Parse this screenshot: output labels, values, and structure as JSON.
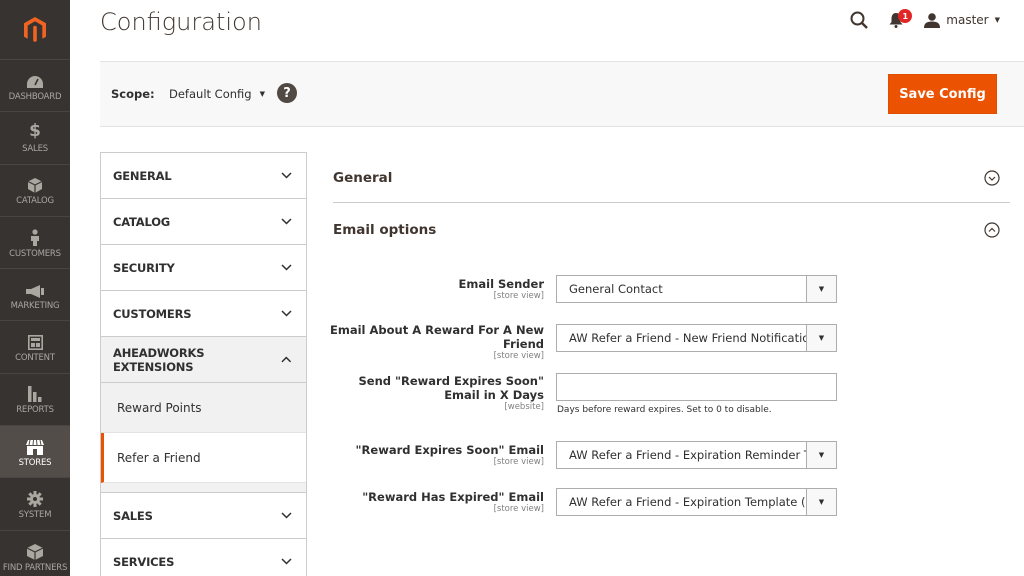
{
  "sidebar": {
    "items": [
      {
        "label": "DASHBOARD",
        "icon": "dashboard-icon"
      },
      {
        "label": "SALES",
        "icon": "dollar-icon"
      },
      {
        "label": "CATALOG",
        "icon": "cube-icon"
      },
      {
        "label": "CUSTOMERS",
        "icon": "person-icon"
      },
      {
        "label": "MARKETING",
        "icon": "megaphone-icon"
      },
      {
        "label": "CONTENT",
        "icon": "layout-icon"
      },
      {
        "label": "REPORTS",
        "icon": "bar-chart-icon"
      },
      {
        "label": "STORES",
        "icon": "store-icon",
        "active": true
      },
      {
        "label": "SYSTEM",
        "icon": "gear-icon"
      },
      {
        "label": "FIND PARTNERS",
        "icon": "partners-icon"
      }
    ]
  },
  "header": {
    "title": "Configuration",
    "notifications_count": "1",
    "user_name": "master"
  },
  "scope": {
    "label": "Scope:",
    "value": "Default Config",
    "save_label": "Save Config"
  },
  "tabs": [
    {
      "label": "GENERAL"
    },
    {
      "label": "CATALOG"
    },
    {
      "label": "SECURITY"
    },
    {
      "label": "CUSTOMERS"
    },
    {
      "label": "AHEADWORKS EXTENSIONS",
      "open": true
    },
    {
      "label": "SALES"
    },
    {
      "label": "SERVICES"
    }
  ],
  "subtabs": [
    {
      "label": "Reward Points"
    },
    {
      "label": "Refer a Friend",
      "active": true
    }
  ],
  "sections": {
    "general": "General",
    "email_options": "Email options"
  },
  "fields": {
    "email_sender": {
      "label": "Email Sender",
      "scope": "[store view]",
      "value": "General Contact"
    },
    "reward_new_friend": {
      "label": "Email About A Reward For A New Friend",
      "scope": "[store view]",
      "value": "AW Refer a Friend - New Friend Notification"
    },
    "expires_days": {
      "label": "Send \"Reward Expires Soon\" Email in X Days",
      "scope": "[website]",
      "value": "",
      "note": "Days before reward expires. Set to 0 to disable."
    },
    "expires_soon": {
      "label": "\"Reward Expires Soon\" Email",
      "scope": "[store view]",
      "value": "AW Refer a Friend - Expiration Reminder Template"
    },
    "has_expired": {
      "label": "\"Reward Has Expired\" Email",
      "scope": "[store view]",
      "value": "AW Refer a Friend - Expiration Template (Default)"
    }
  },
  "colors": {
    "accent": "#eb5202",
    "nav_bg": "#373330",
    "nav_active": "#524d49"
  }
}
